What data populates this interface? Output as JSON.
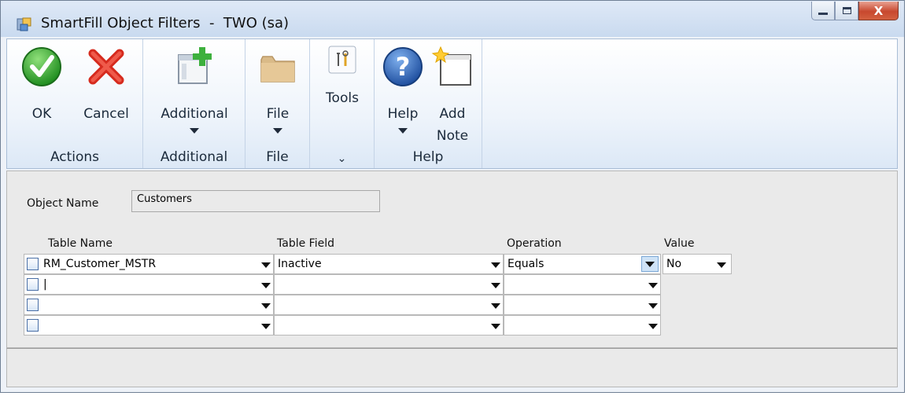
{
  "window": {
    "title": "SmartFill Object Filters  -  TWO (sa)",
    "icons": {
      "app": "smartfill-app-icon",
      "minimize": "minimize-icon",
      "maximize": "maximize-icon",
      "close": "close-icon"
    },
    "close_glyph": "X"
  },
  "ribbon": {
    "groups": {
      "actions": "Actions",
      "additional": "Additional",
      "file": "File",
      "tools": "⌄",
      "help": "Help"
    },
    "buttons": {
      "ok": "OK",
      "cancel": "Cancel",
      "additional": "Additional",
      "file": "File",
      "tools": "Tools",
      "help": "Help",
      "add_note_1": "Add",
      "add_note_2": "Note"
    }
  },
  "form": {
    "object_name_label": "Object Name",
    "object_name_value": "Customers",
    "columns": {
      "table_name": "Table Name",
      "table_field": "Table Field",
      "operation": "Operation",
      "value": "Value"
    },
    "rows": [
      {
        "table_name": "RM_Customer_MSTR",
        "table_field": "Inactive",
        "operation": "Equals",
        "value": "No"
      },
      {
        "table_name": "|",
        "table_field": "",
        "operation": ""
      },
      {
        "table_name": "",
        "table_field": "",
        "operation": ""
      },
      {
        "table_name": "",
        "table_field": "",
        "operation": ""
      }
    ]
  },
  "colors": {
    "accent": "#3d76c8",
    "ok_green": "#2e9e2e",
    "cancel_red": "#d62b1e"
  }
}
